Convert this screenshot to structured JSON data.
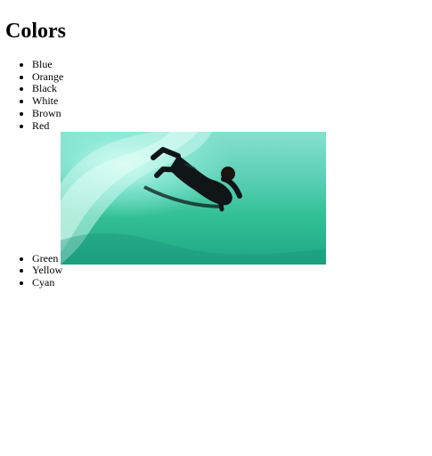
{
  "page": {
    "title": "Colors",
    "colors_before_image": [
      "Blue",
      "Orange",
      "Black",
      "White",
      "Brown",
      "Red"
    ],
    "colors_after_image": [
      "Green",
      "Yellow",
      "Cyan"
    ],
    "image": {
      "alt": "Surfer on green wave"
    }
  }
}
